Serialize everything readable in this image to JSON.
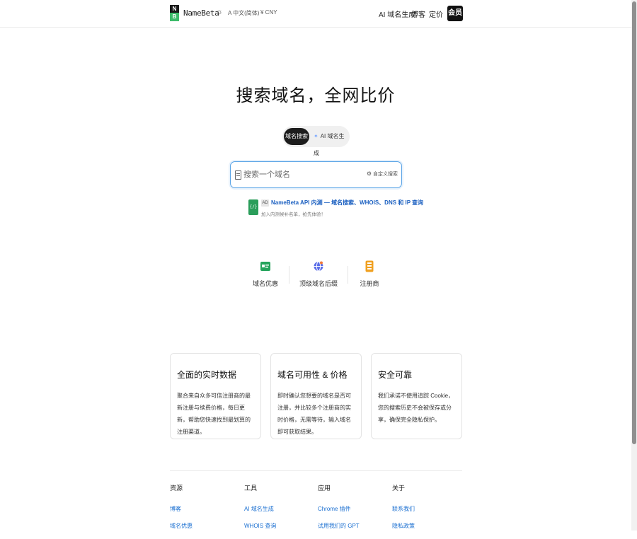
{
  "header": {
    "logo_top": "N",
    "logo_bottom": "B",
    "brand": "NameBeta",
    "theme_icon": "sun-icon",
    "language": "A 中文(简体)",
    "currency": "¥ CNY",
    "nav": [
      "AI 域名生成",
      "博客",
      "定价"
    ],
    "member_label": "会员"
  },
  "hero": {
    "title": "搜索域名，全网比价",
    "mode_search": "域名搜索",
    "mode_ai": "AI 域名生成",
    "search_placeholder": "搜索一个域名",
    "custom_search": "自定义搜索"
  },
  "ad": {
    "icon_text": "{/}",
    "badge": "AD",
    "title": "NameBeta API 内测 — 域名搜索、WHOIS、DNS 和 IP 查询",
    "subtitle": "加入内测候补名单，抢先体验！"
  },
  "quick_links": [
    {
      "label": "域名优惠",
      "icon": "coupon-icon",
      "color": "#23a35b"
    },
    {
      "label": "顶级域名后缀",
      "icon": "globe-icon",
      "color": "#5b6ee8"
    },
    {
      "label": "注册商",
      "icon": "building-icon",
      "color": "#f0a020"
    }
  ],
  "cards": [
    {
      "title": "全面的实时数据",
      "text": "聚合来自众多可信注册商的最新注册与续费价格，每日更新，帮助您快速找到最划算的注册渠道。"
    },
    {
      "title": "域名可用性 & 价格",
      "text": "即时确认您想要的域名是否可注册，并比较多个注册商的实时价格，无需等待，输入域名即可获取结果。"
    },
    {
      "title": "安全可靠",
      "text": "我们承诺不使用追踪 Cookie，您的搜索历史不会被保存或分享，确保完全隐私保护。"
    }
  ],
  "footer": {
    "columns": [
      {
        "heading": "资源",
        "links": [
          "博客",
          "域名优惠"
        ]
      },
      {
        "heading": "工具",
        "links": [
          "AI 域名生成",
          "WHOIS 查询"
        ]
      },
      {
        "heading": "应用",
        "links": [
          "Chrome 插件",
          "试用我们的 GPT"
        ]
      },
      {
        "heading": "关于",
        "links": [
          "联系我们",
          "隐私政策"
        ]
      }
    ]
  },
  "colors": {
    "accent_blue": "#5aa4e6",
    "link_blue": "#1a6fd1",
    "brand_green": "#3dbb6a",
    "dark": "#111111"
  }
}
